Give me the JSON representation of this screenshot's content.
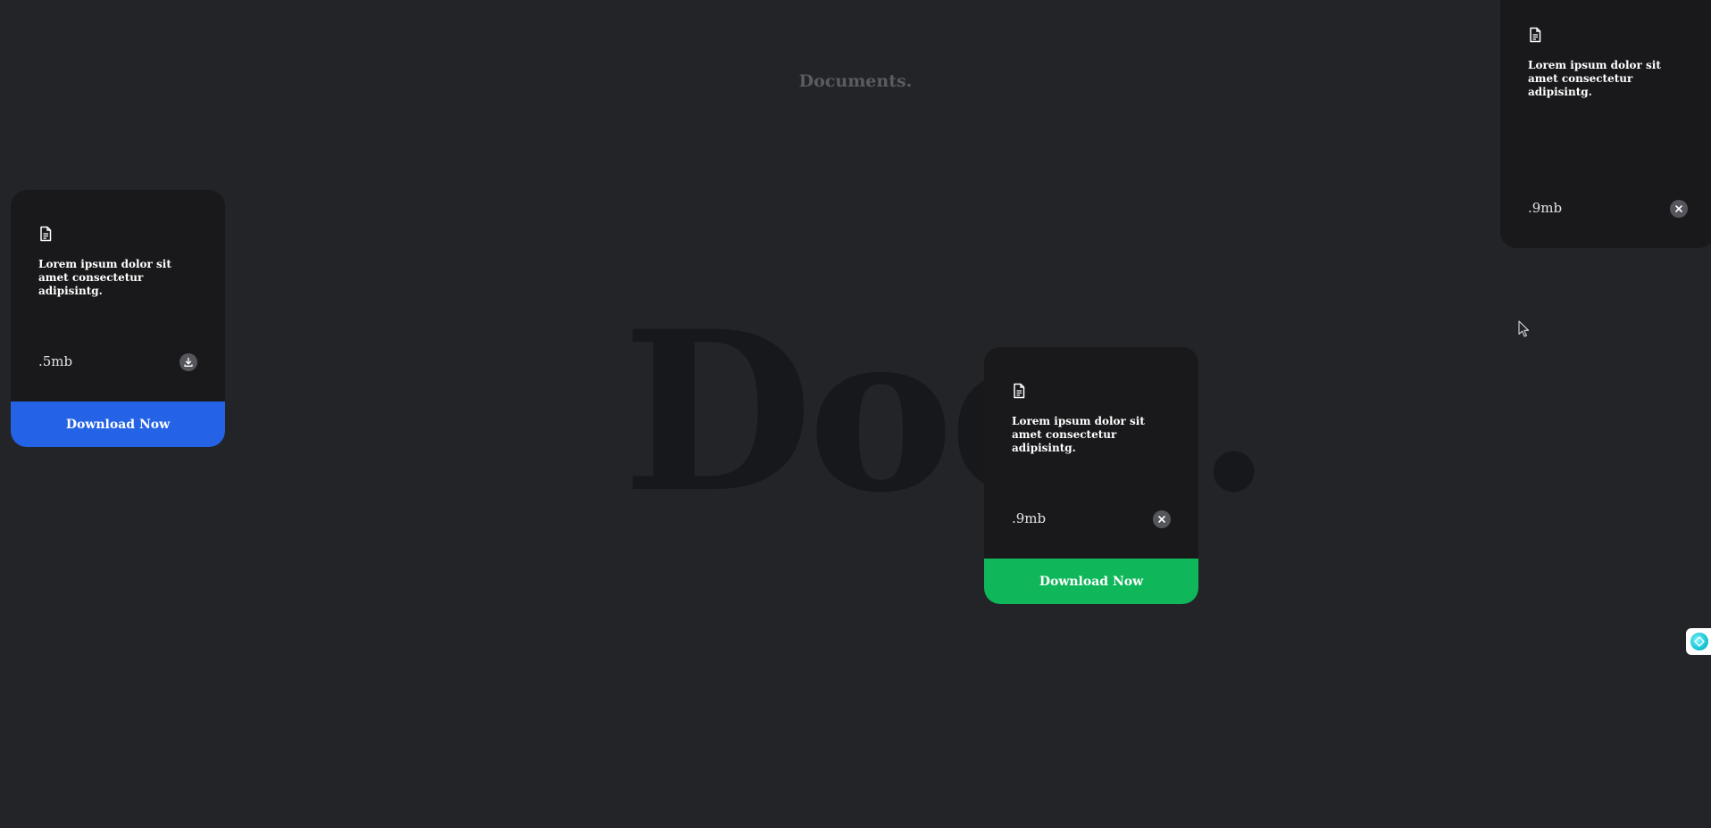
{
  "page": {
    "heading": "Documents.",
    "watermark": "Docs."
  },
  "cards": [
    {
      "description": "Lorem ipsum dolor sit amet consectetur adipisintg.",
      "size": ".5mb",
      "action_icon": "download-icon",
      "button_label": "Download Now",
      "button_color": "#2563e6"
    },
    {
      "description": "Lorem ipsum dolor sit amet consectetur adipisintg.",
      "size": ".9mb",
      "action_icon": "close-icon",
      "button_label": "Download Now",
      "button_color": "#0fb75a"
    },
    {
      "description": "Lorem ipsum dolor sit amet consectetur adipisintg.",
      "size": ".9mb",
      "action_icon": "close-icon"
    }
  ],
  "colors": {
    "background": "#232428",
    "card": "#19191b",
    "blue": "#2563e6",
    "green": "#0fb75a"
  },
  "icons": {
    "document": "document-icon",
    "cursor": "mouse-pointer-icon",
    "widget": "assistant-orb-icon"
  }
}
